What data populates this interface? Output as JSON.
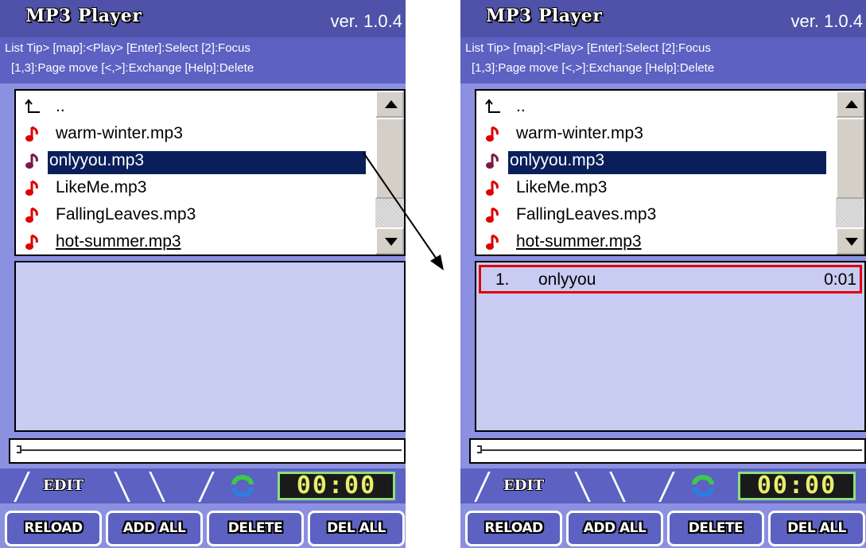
{
  "app": {
    "title": "MP3 Player",
    "version": "ver. 1.0.4",
    "tip_line1": "List Tip> [map]:<Play> [Enter]:Select [2]:Focus",
    "tip_line2": "[1,3]:Page move [<,>]:Exchange [Help]:Delete"
  },
  "file_list": {
    "items": [
      {
        "label": "..",
        "icon": "parent-folder-icon"
      },
      {
        "label": "warm-winter.mp3",
        "icon": "music-note-icon"
      },
      {
        "label": "onlyyou.mp3",
        "icon": "music-note-icon",
        "selected": true
      },
      {
        "label": "LikeMe.mp3",
        "icon": "music-note-icon"
      },
      {
        "label": "FallingLeaves.mp3",
        "icon": "music-note-icon"
      },
      {
        "label": "hot-summer.mp3",
        "icon": "music-note-icon"
      }
    ]
  },
  "playlist_after": {
    "number": "1.",
    "name": "onlyyou",
    "time": "0:01"
  },
  "controls": {
    "tab_edit": "EDIT",
    "clock": "00:00",
    "buttons": [
      "RELOAD",
      "ADD ALL",
      "DELETE",
      "DEL ALL"
    ]
  },
  "colors": {
    "panel_bg": "#8c90e0",
    "titlebar_bg": "#4f52a8",
    "selection_bg": "#0a1f5a",
    "highlight_border": "#e00000",
    "clock_text": "#e9ee6a"
  }
}
